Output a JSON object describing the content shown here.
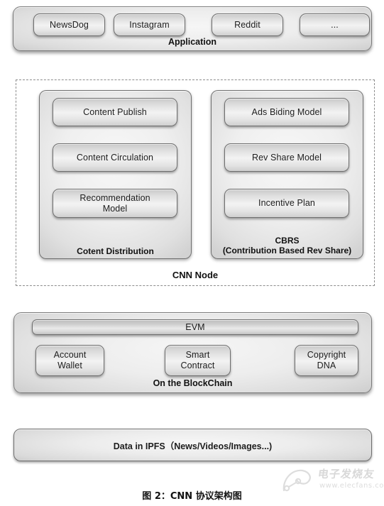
{
  "diagram": {
    "caption": "图 2：CNN 协议架构图",
    "watermark": {
      "text": "电子发烧友",
      "url": "www.elecfans.com",
      "icon": "elecfans-logo-icon"
    }
  },
  "layers": {
    "application": {
      "label": "Application",
      "items": [
        {
          "label": "NewsDog"
        },
        {
          "label": "Instagram"
        },
        {
          "label": "Reddit"
        },
        {
          "label": "..."
        }
      ]
    },
    "cnn_node": {
      "label_bold": "CNN",
      "label_rest": " Node",
      "label": "CNN Node",
      "panels": [
        {
          "label": "Cotent Distribution",
          "items": [
            {
              "label": "Content Publish"
            },
            {
              "label": "Content Circulation"
            },
            {
              "label": "Recommendation\nModel"
            }
          ]
        },
        {
          "label": "CBRS\n(Contribution Based Rev Share)",
          "items": [
            {
              "label": "Ads Biding Model"
            },
            {
              "label": "Rev Share Model"
            },
            {
              "label": "Incentive Plan"
            }
          ]
        }
      ]
    },
    "blockchain": {
      "label": "On the BlockChain",
      "evm": "EVM",
      "items": [
        {
          "label": "Account\nWallet"
        },
        {
          "label": "Smart\nContract"
        },
        {
          "label": "Copyright\nDNA"
        }
      ]
    },
    "storage": {
      "label": "Data in IPFS（News/Videos/Images...)"
    }
  },
  "colors": {
    "box_border": "#6e6e6e",
    "box_fill_light": "#f3f3f3",
    "box_fill_dark": "#c9c9c9",
    "dashed_border": "#8c8c8c",
    "text": "#1d1d1d",
    "page_background": "#ffffff"
  }
}
